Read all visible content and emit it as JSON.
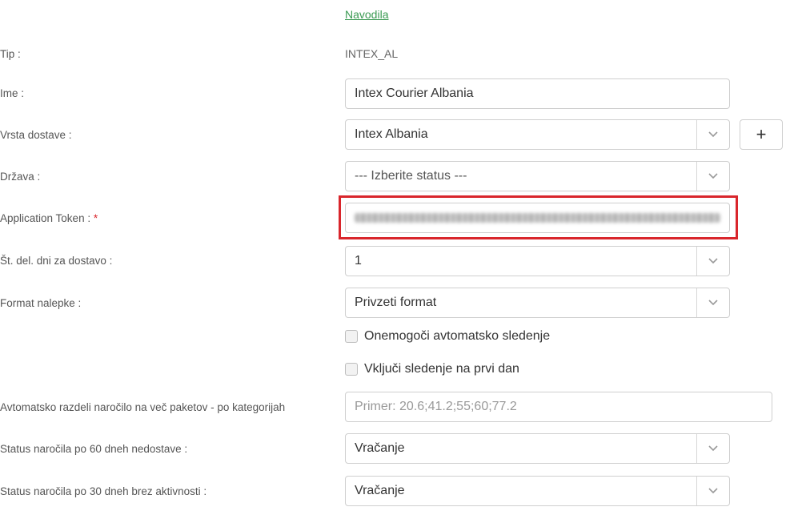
{
  "instructions_link": "Navodila",
  "fields": {
    "tip": {
      "label": "Tip :",
      "value": "INTEX_AL"
    },
    "ime": {
      "label": "Ime :",
      "value": "Intex Courier Albania"
    },
    "vrsta_dostave": {
      "label": "Vrsta dostave :",
      "value": "Intex Albania",
      "add_label": "+"
    },
    "drzava": {
      "label": "Država :",
      "value": "--- Izberite status ---"
    },
    "token": {
      "label": "Application Token :",
      "required_mark": "*"
    },
    "st_dni": {
      "label": "Št. del. dni za dostavo :",
      "value": "1"
    },
    "format": {
      "label": "Format nalepke :",
      "value": "Privzeti format"
    },
    "razdeli": {
      "label": "Avtomatsko razdeli naročilo na več paketov - po kategorijah",
      "placeholder": "Primer: 20.6;41.2;55;60;77.2"
    },
    "status60": {
      "label": "Status naročila po 60 dneh nedostave :",
      "value": "Vračanje"
    },
    "status30": {
      "label": "Status naročila po 30 dneh brez aktivnosti :",
      "value": "Vračanje"
    }
  },
  "checkboxes": {
    "disable_tracking": "Onemogoči avtomatsko sledenje",
    "first_day_tracking": "Vključi sledenje na prvi dan"
  },
  "colors": {
    "link": "#3a9a52",
    "highlight": "#d9262c"
  }
}
